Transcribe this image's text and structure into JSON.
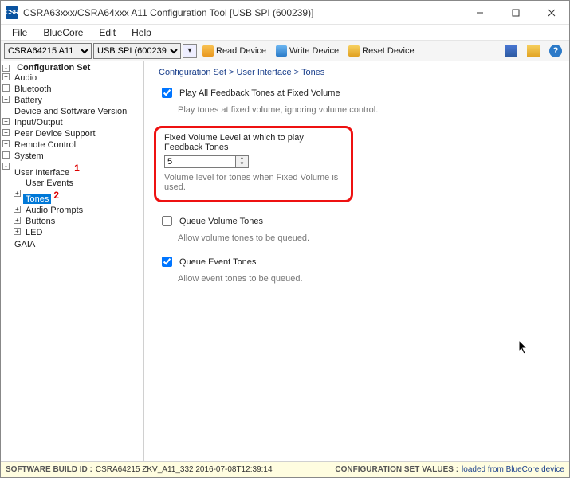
{
  "window": {
    "title": "CSRA63xxx/CSRA64xxx A11 Configuration Tool [USB SPI (600239)]",
    "app_icon_text": "CSR"
  },
  "menubar": [
    "File",
    "BlueCore",
    "Edit",
    "Help"
  ],
  "toolbar": {
    "device_combo": "CSRA64215 A11",
    "conn_combo": "USB SPI (600239)",
    "read": "Read Device",
    "write": "Write Device",
    "reset": "Reset Device"
  },
  "tree": {
    "root": "Configuration Set",
    "items": [
      {
        "label": "Audio",
        "exp": "+"
      },
      {
        "label": "Bluetooth",
        "exp": "+"
      },
      {
        "label": "Battery",
        "exp": "+"
      },
      {
        "label": "Device and Software Version",
        "exp": null
      },
      {
        "label": "Input/Output",
        "exp": "+"
      },
      {
        "label": "Peer Device Support",
        "exp": "+"
      },
      {
        "label": "Remote Control",
        "exp": "+"
      },
      {
        "label": "System",
        "exp": "+"
      }
    ],
    "ui_item": {
      "label": "User Interface",
      "exp": "-",
      "annot": "1"
    },
    "ui_children": [
      {
        "label": "User Events",
        "exp": null
      },
      {
        "label": "Tones",
        "exp": "+",
        "selected": true,
        "annot": "2"
      },
      {
        "label": "Audio Prompts",
        "exp": "+"
      },
      {
        "label": "Buttons",
        "exp": "+"
      },
      {
        "label": "LED",
        "exp": "+"
      }
    ],
    "gaia": {
      "label": "GAIA",
      "exp": null
    }
  },
  "content": {
    "breadcrumb": "Configuration Set > User Interface > Tones",
    "play_all": {
      "label": "Play All Feedback Tones at Fixed Volume",
      "desc": "Play tones at fixed volume, ignoring volume control.",
      "checked": true
    },
    "fixed_vol": {
      "label": "Fixed Volume Level at which to play Feedback Tones",
      "value": "5",
      "desc": "Volume level for tones when Fixed Volume is used."
    },
    "queue_vol": {
      "label": "Queue Volume Tones",
      "desc": "Allow volume tones to be queued.",
      "checked": false
    },
    "queue_evt": {
      "label": "Queue Event Tones",
      "desc": "Allow event tones to be queued.",
      "checked": true
    }
  },
  "statusbar": {
    "build_label": "SOFTWARE BUILD ID :",
    "build_value": "CSRA64215 ZKV_A11_332 2016-07-08T12:39:14",
    "cfg_label": "CONFIGURATION SET VALUES :",
    "cfg_value": "loaded from BlueCore device"
  }
}
